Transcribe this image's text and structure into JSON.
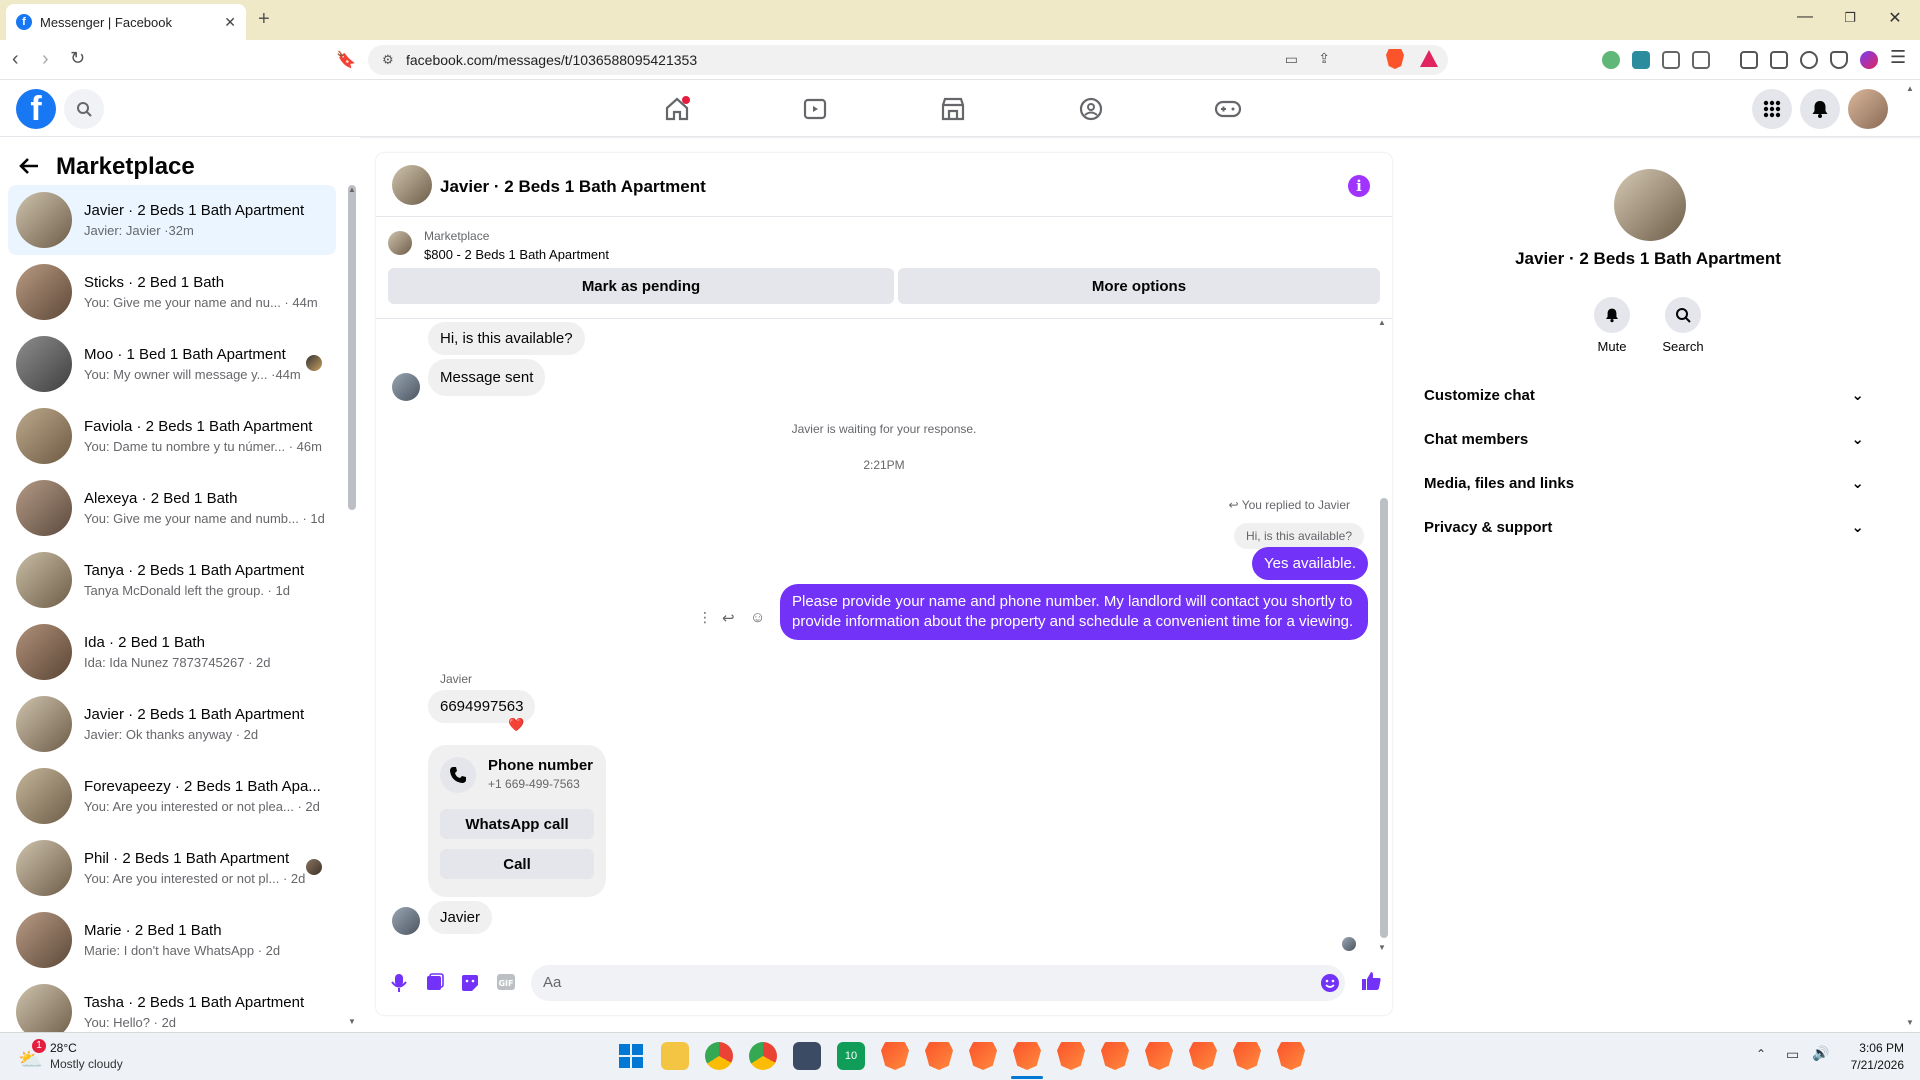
{
  "browser": {
    "tab_title": "Messenger | Facebook",
    "url": "facebook.com/messages/t/1036588095421353"
  },
  "sidebar": {
    "title": "Marketplace",
    "conversations": [
      {
        "title": "Javier · 2 Beds 1 Bath Apartment",
        "snippet": "Javier: Javier ·32m",
        "active": true
      },
      {
        "title": "Sticks · 2 Bed 1 Bath",
        "snippet": "You: Give me your name and nu... · 44m"
      },
      {
        "title": "Moo · 1 Bed 1 Bath Apartment",
        "snippet": "You: My owner will message y... ·44m"
      },
      {
        "title": "Faviola · 2 Beds 1 Bath Apartment",
        "snippet": "You: Dame tu nombre y tu númer... · 46m"
      },
      {
        "title": "Alexeya · 2 Bed 1 Bath",
        "snippet": "You: Give me your name and numb... · 1d"
      },
      {
        "title": "Tanya · 2 Beds 1 Bath Apartment",
        "snippet": "Tanya McDonald left the group. · 1d"
      },
      {
        "title": "Ida · 2 Bed 1 Bath",
        "snippet": "Ida: Ida Nunez 7873745267 · 2d"
      },
      {
        "title": "Javier · 2 Beds 1 Bath Apartment",
        "snippet": "Javier: Ok thanks anyway · 2d"
      },
      {
        "title": "Forevapeezy · 2 Beds 1 Bath Apa...",
        "snippet": "You: Are you interested or not plea... · 2d"
      },
      {
        "title": "Phil · 2 Beds 1 Bath Apartment",
        "snippet": "You: Are you interested or not pl... · 2d"
      },
      {
        "title": "Marie · 2 Bed 1 Bath",
        "snippet": "Marie: I don't have WhatsApp · 2d"
      },
      {
        "title": "Tasha · 2 Beds 1 Bath Apartment",
        "snippet": "You: Hello? · 2d"
      }
    ]
  },
  "chat": {
    "name": "Javier · 2 Beds 1 Bath Apartment",
    "marketplace_label": "Marketplace",
    "listing": "$800 - 2 Beds 1 Bath Apartment",
    "mark_pending": "Mark as pending",
    "more_options": "More options",
    "msg_available": "Hi, is this available?",
    "msg_sent": "Message sent",
    "waiting": "Javier is waiting for your response.",
    "time": "2:21PM",
    "replied_to": "You replied to Javier",
    "quoted": "Hi, is this available?",
    "reply_yes": "Yes available.",
    "reply_long": "Please provide your name and phone number. My landlord will contact you shortly to provide information about the property and schedule a convenient time for a viewing.",
    "sender_name": "Javier",
    "phone_msg": "6694997563",
    "reaction": "❤️",
    "phone_card_title": "Phone number",
    "phone_card_number": "+1 669-499-7563",
    "whatsapp_call": "WhatsApp call",
    "call": "Call",
    "last_msg": "Javier",
    "composer_placeholder": "Aa"
  },
  "details": {
    "name": "Javier · 2 Beds 1 Bath Apartment",
    "mute": "Mute",
    "search": "Search",
    "sections": [
      "Customize chat",
      "Chat members",
      "Media, files and links",
      "Privacy & support"
    ]
  },
  "taskbar": {
    "temp": "28°C",
    "weather": "Mostly cloudy",
    "time": "3:06 PM",
    "date": "7/21/2026",
    "badge": "1"
  },
  "colors": {
    "accent": "#7232f7",
    "fb_blue": "#1877f2",
    "info": "#a033ff"
  }
}
